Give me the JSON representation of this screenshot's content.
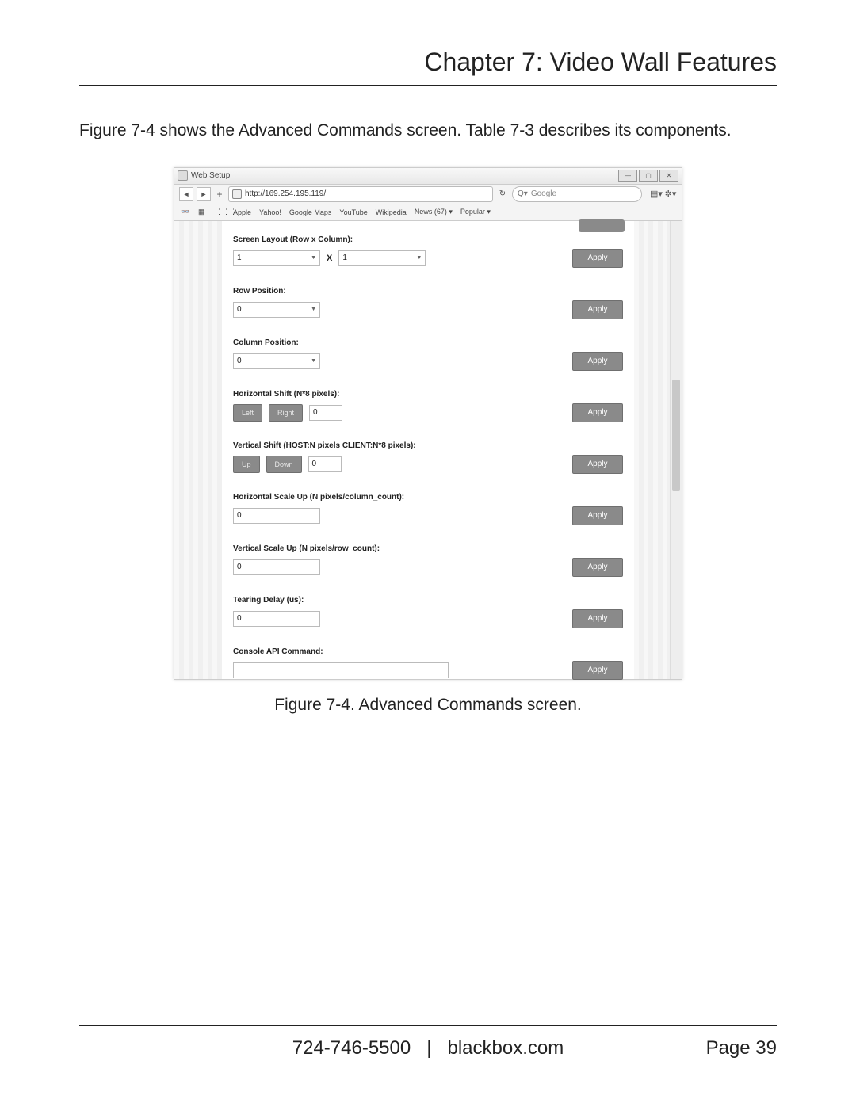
{
  "doc": {
    "chapter_title": "Chapter 7: Video Wall Features",
    "intro": "Figure 7-4 shows the Advanced Commands screen. Table 7-3 describes its components.",
    "caption": "Figure 7-4. Advanced Commands screen.",
    "footer_phone": "724-746-5500",
    "footer_sep": "|",
    "footer_site": "blackbox.com",
    "footer_page": "Page 39"
  },
  "browser": {
    "window_title": "Web Setup",
    "url": "http://169.254.195.119/",
    "search_placeholder": "Google",
    "search_prefix": "Q▾",
    "bookmarks": [
      "Apple",
      "Yahoo!",
      "Google Maps",
      "YouTube",
      "Wikipedia",
      "News (67) ▾",
      "Popular ▾"
    ]
  },
  "form": {
    "apply_label": "Apply",
    "screen_layout": {
      "label": "Screen Layout (Row x Column):",
      "row": "1",
      "x": "X",
      "col": "1"
    },
    "row_position": {
      "label": "Row Position:",
      "value": "0"
    },
    "column_position": {
      "label": "Column Position:",
      "value": "0"
    },
    "h_shift": {
      "label": "Horizontal Shift (N*8 pixels):",
      "left": "Left",
      "right": "Right",
      "value": "0"
    },
    "v_shift": {
      "label": "Vertical Shift (HOST:N pixels CLIENT:N*8 pixels):",
      "up": "Up",
      "down": "Down",
      "value": "0"
    },
    "h_scale": {
      "label": "Horizontal Scale Up (N pixels/column_count):",
      "value": "0"
    },
    "v_scale": {
      "label": "Vertical Scale Up (N pixels/row_count):",
      "value": "0"
    },
    "tearing": {
      "label": "Tearing Delay (us):",
      "value": "0"
    },
    "api": {
      "label": "Console API Command:",
      "value": ""
    }
  }
}
